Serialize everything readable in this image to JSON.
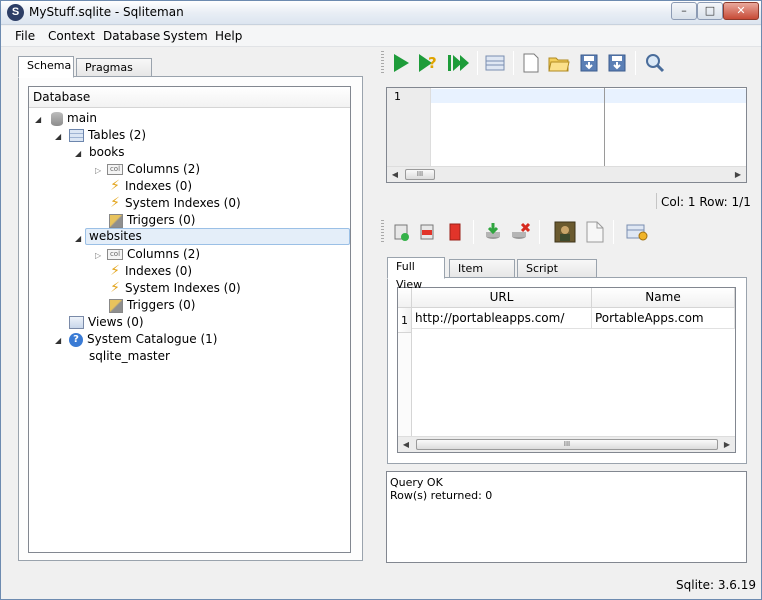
{
  "window": {
    "title": "MyStuff.sqlite - Sqliteman",
    "app_icon": "S"
  },
  "menu": [
    {
      "label": "File"
    },
    {
      "label": "Context"
    },
    {
      "label": "Database"
    },
    {
      "label": "System"
    },
    {
      "label": "Help"
    }
  ],
  "left_tabs": {
    "schema": "Schema",
    "pragmas": "Pragmas"
  },
  "tree": {
    "header": "Database",
    "nodes": {
      "main": "main",
      "tables": "Tables (2)",
      "books": "books",
      "books_columns": "Columns (2)",
      "books_indexes": "Indexes (0)",
      "books_sysindexes": "System Indexes (0)",
      "books_triggers": "Triggers (0)",
      "websites": "websites",
      "websites_columns": "Columns (2)",
      "websites_indexes": "Indexes (0)",
      "websites_sysindexes": "System Indexes (0)",
      "websites_triggers": "Triggers (0)",
      "views": "Views (0)",
      "system_catalogue": "System Catalogue (1)",
      "sqlite_master": "sqlite_master"
    },
    "column_icon_text": "col"
  },
  "editor": {
    "line_number": "1"
  },
  "status": {
    "col_row": "Col: 1 Row: 1/1"
  },
  "result_tabs": {
    "full_view": "Full View",
    "item_view": "Item View",
    "script_output": "Script Output"
  },
  "grid": {
    "columns": [
      "URL",
      "Name"
    ],
    "rows": [
      {
        "num": "1",
        "cells": [
          "http://portableapps.com/",
          "PortableApps.com"
        ]
      }
    ]
  },
  "message": {
    "line1": "Query OK",
    "line2": "Row(s) returned: 0"
  },
  "statusbar": {
    "version": "Sqlite: 3.6.19"
  },
  "scroll_thumb_text": "III",
  "colors": {
    "accent": "#16a34a",
    "selection": "#e4eef9"
  }
}
